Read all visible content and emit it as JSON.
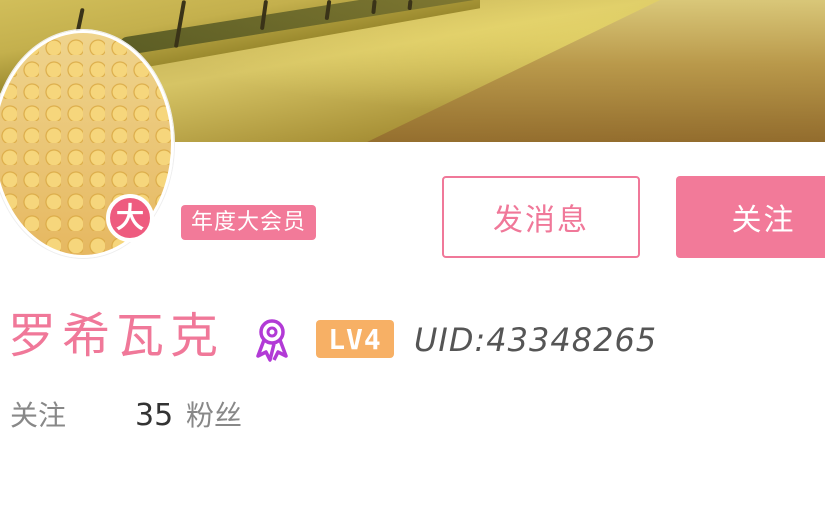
{
  "profile": {
    "vip_glyph": "大",
    "member_tag": "年度大会员",
    "username": "罗希瓦克",
    "level": "LV4",
    "uid": "UID:43348265"
  },
  "actions": {
    "message_label": "发消息",
    "follow_label": "关注"
  },
  "stats": {
    "following_label": "关注",
    "followers_count": "35",
    "followers_label": "粉丝"
  },
  "colors": {
    "accent_pink": "#f27a99",
    "level_orange": "#f7b065",
    "badge_purple": "#b23ad6"
  },
  "icons": {
    "achievement": "medal-icon"
  }
}
